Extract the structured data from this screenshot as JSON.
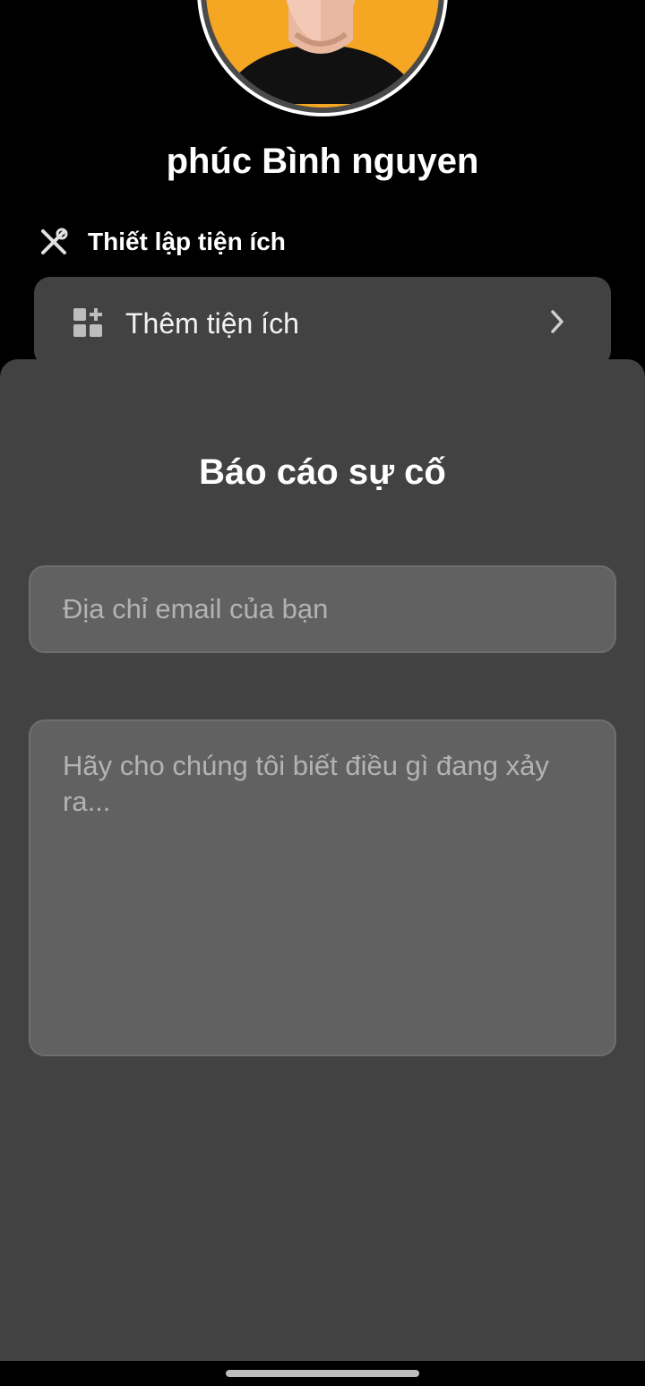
{
  "profile": {
    "name": "phúc Bình nguyen",
    "avatar_color": "#f5a623"
  },
  "widget_settings": {
    "header_icon": "tools-icon",
    "header_label": "Thiết lập tiện ích",
    "add_widget_icon": "widgets-add-icon",
    "add_widget_label": "Thêm tiện ích",
    "chevron_icon": "chevron-right-icon"
  },
  "report_sheet": {
    "title": "Báo cáo sự cố",
    "email_placeholder": "Địa chỉ email của bạn",
    "message_placeholder": "Hãy cho chúng tôi biết điều gì đang xảy ra..."
  },
  "colors": {
    "background": "#000000",
    "card": "#424242",
    "field": "#616161",
    "accent": "#f5a623"
  }
}
